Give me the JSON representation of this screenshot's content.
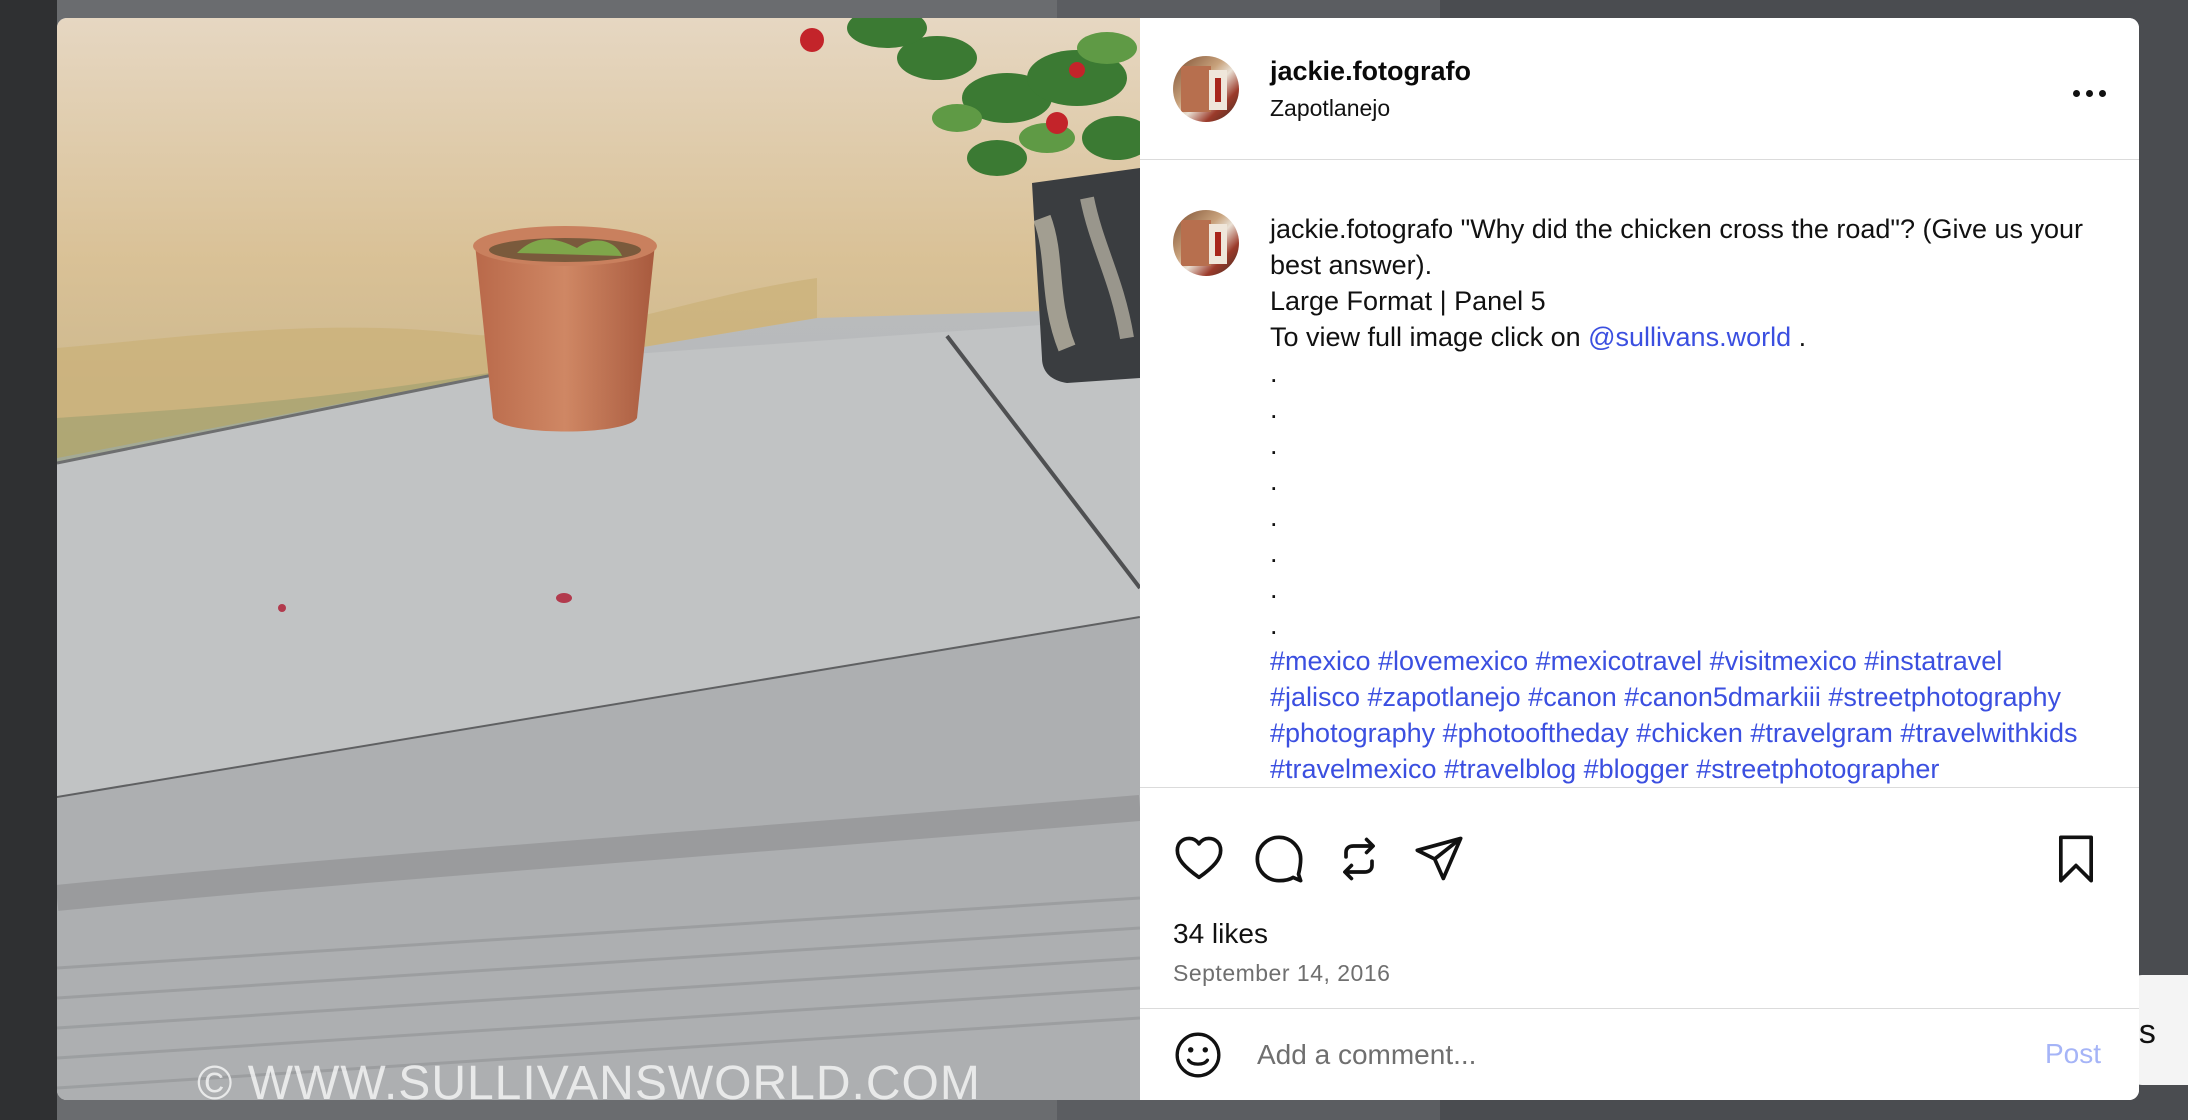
{
  "post": {
    "username": "jackie.fotografo",
    "location": "Zapotlanejo",
    "watermark": "© WWW.SULLIVANSWORLD.COM"
  },
  "caption": {
    "username": "jackie.fotografo",
    "text_line1": " \"Why did the chicken cross the road\"? (Give us your best answer).",
    "text_line2": "Large Format | Panel 5",
    "text_line3": "To view full image click on ",
    "mention": "@sullivans.world",
    "text_line3_end": " .",
    "dots": [
      ".",
      ".",
      ".",
      ".",
      ".",
      ".",
      ".",
      "."
    ],
    "hashtags": "#mexico #lovemexico #mexicotravel #visitmexico #instatravel #jalisco #zapotlanejo #canon #canon5dmarkiii #streetphotography #photography #photooftheday #chicken #travelgram #travelwithkids #travelmexico #travelblog #blogger #streetphotographer #wanderlust #sullivansworld"
  },
  "actions": {
    "icons": [
      "heart-icon",
      "comment-icon",
      "repost-icon",
      "share-icon",
      "bookmark-icon"
    ]
  },
  "stats": {
    "likes": "34 likes",
    "date": "September 14, 2016"
  },
  "comment": {
    "placeholder": "Add a comment...",
    "post_label": "Post"
  },
  "background": {
    "partial_text": "es"
  },
  "colors": {
    "link": "#3b4fe0",
    "post_disabled": "#a5b4f7",
    "divider": "#dbdbdb"
  }
}
